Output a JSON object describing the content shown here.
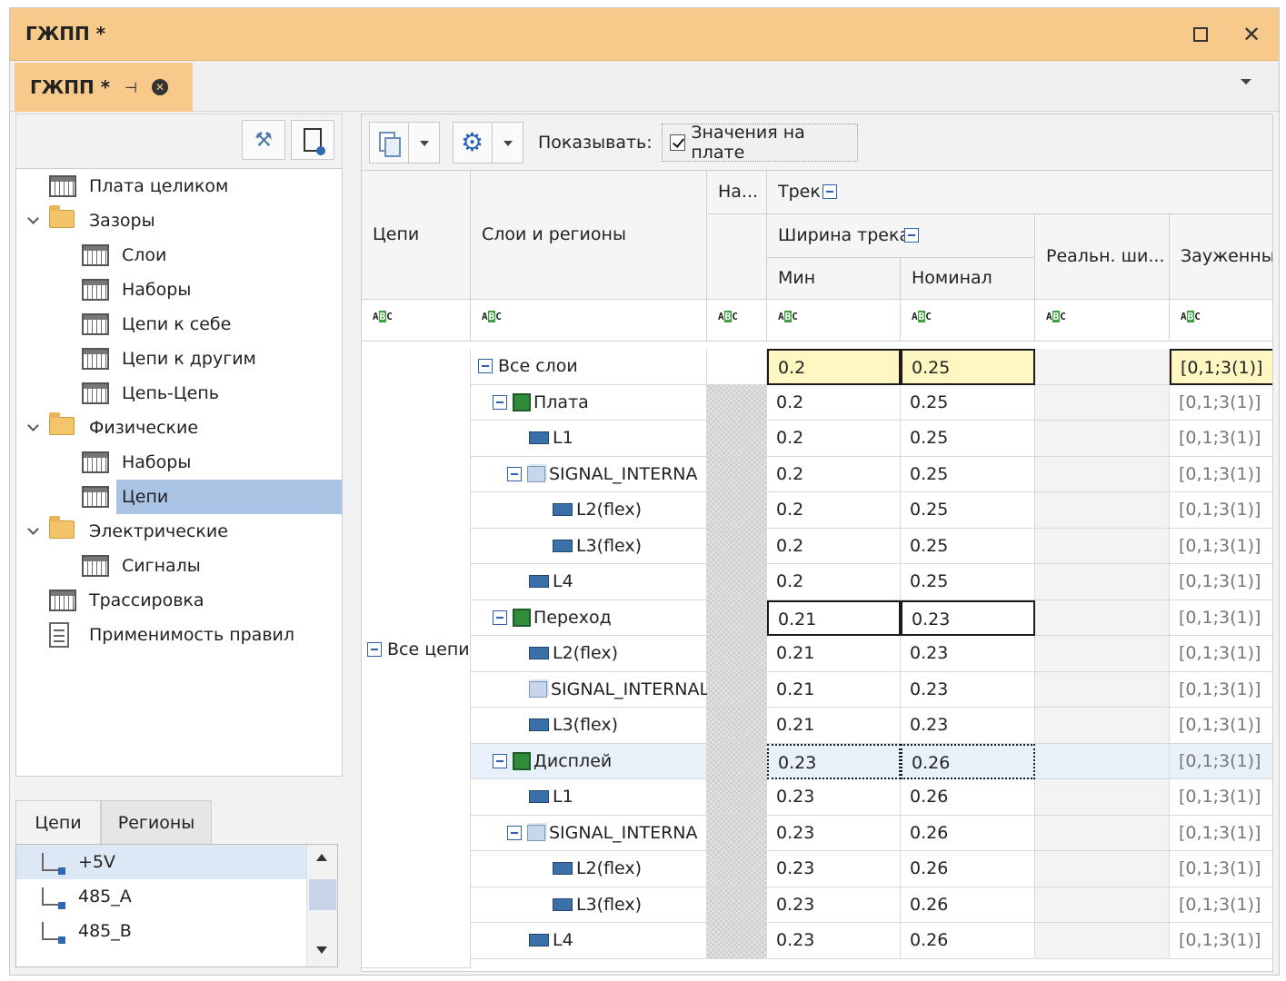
{
  "window": {
    "title": "ГЖПП *"
  },
  "doc_tab": {
    "label": "ГЖПП *"
  },
  "tree": [
    {
      "label": "Плата целиком",
      "icon": "grid-icon",
      "level": 0,
      "expander": false
    },
    {
      "label": "Зазоры",
      "icon": "folder-icon",
      "level": 0,
      "expander": true
    },
    {
      "label": "Слои",
      "icon": "grid-icon",
      "level": 1
    },
    {
      "label": "Наборы",
      "icon": "grid-icon",
      "level": 1
    },
    {
      "label": "Цепи к себе",
      "icon": "grid-icon",
      "level": 1
    },
    {
      "label": "Цепи к другим",
      "icon": "grid-icon",
      "level": 1
    },
    {
      "label": "Цепь-Цепь",
      "icon": "grid-icon",
      "level": 1
    },
    {
      "label": "Физические",
      "icon": "folder-icon",
      "level": 0,
      "expander": true
    },
    {
      "label": "Наборы",
      "icon": "grid-icon",
      "level": 1
    },
    {
      "label": "Цепи",
      "icon": "grid-icon",
      "level": 1,
      "selected": true
    },
    {
      "label": "Электрические",
      "icon": "folder-icon",
      "level": 0,
      "expander": true
    },
    {
      "label": "Сигналы",
      "icon": "grid-icon",
      "level": 1
    },
    {
      "label": "Трассировка",
      "icon": "grid-icon",
      "level": 0
    },
    {
      "label": "Применимость правил",
      "icon": "doc-icon",
      "level": 0
    }
  ],
  "bottom_tabs": [
    "Цепи",
    "Регионы"
  ],
  "nets": [
    "+5V",
    "485_A",
    "485_B"
  ],
  "toolbar": {
    "show_label": "Показывать:",
    "checkbox_label": "Значения на плате"
  },
  "columns": {
    "nets": "Цепи",
    "layers": "Слои и регионы",
    "na": "На...",
    "track": "Трек",
    "width": "Ширина трека",
    "min": "Мин",
    "nominal": "Номинал",
    "real": "Реальн. ши...",
    "neck": "Зауженный"
  },
  "all_nets": "Все цепи",
  "rows": [
    {
      "name": "Все слои",
      "indent": 0,
      "icon": "",
      "expand": true,
      "min": "0.2",
      "nom": "0.25",
      "neck": "[0,1;3(1)]",
      "style": "yellow",
      "hatch": false
    },
    {
      "name": "Плата",
      "indent": 1,
      "icon": "board",
      "expand": true,
      "min": "0.2",
      "nom": "0.25",
      "neck": "[0,1;3(1)]",
      "hatch": true
    },
    {
      "name": "L1",
      "indent": 2,
      "icon": "layer",
      "min": "0.2",
      "nom": "0.25",
      "neck": "[0,1;3(1)]",
      "hatch": true
    },
    {
      "name": "SIGNAL_INTERNA",
      "indent": 2,
      "icon": "set",
      "expand": true,
      "min": "0.2",
      "nom": "0.25",
      "neck": "[0,1;3(1)]",
      "hatch": true
    },
    {
      "name": "L2(flex)",
      "indent": 3,
      "icon": "layer",
      "min": "0.2",
      "nom": "0.25",
      "neck": "[0,1;3(1)]",
      "hatch": true
    },
    {
      "name": "L3(flex)",
      "indent": 3,
      "icon": "layer",
      "min": "0.2",
      "nom": "0.25",
      "neck": "[0,1;3(1)]",
      "hatch": true
    },
    {
      "name": "L4",
      "indent": 2,
      "icon": "layer",
      "min": "0.2",
      "nom": "0.25",
      "neck": "[0,1;3(1)]",
      "hatch": true
    },
    {
      "name": "Переход",
      "indent": 1,
      "icon": "board",
      "expand": true,
      "min": "0.21",
      "nom": "0.23",
      "neck": "[0,1;3(1)]",
      "style": "boxed",
      "hatch": true
    },
    {
      "name": "L2(flex)",
      "indent": 2,
      "icon": "layer",
      "min": "0.21",
      "nom": "0.23",
      "neck": "[0,1;3(1)]",
      "hatch": true
    },
    {
      "name": "SIGNAL_INTERNAL",
      "indent": 2,
      "icon": "set",
      "min": "0.21",
      "nom": "0.23",
      "neck": "[0,1;3(1)]",
      "hatch": true
    },
    {
      "name": "L3(flex)",
      "indent": 2,
      "icon": "layer",
      "min": "0.21",
      "nom": "0.23",
      "neck": "[0,1;3(1)]",
      "hatch": true
    },
    {
      "name": "Дисплей",
      "indent": 1,
      "icon": "board",
      "expand": true,
      "min": "0.23",
      "nom": "0.26",
      "neck": "[0,1;3(1)]",
      "style": "dotted",
      "hatch": true,
      "selected": true
    },
    {
      "name": "L1",
      "indent": 2,
      "icon": "layer",
      "min": "0.23",
      "nom": "0.26",
      "neck": "[0,1;3(1)]",
      "hatch": true
    },
    {
      "name": "SIGNAL_INTERNA",
      "indent": 2,
      "icon": "set",
      "expand": true,
      "min": "0.23",
      "nom": "0.26",
      "neck": "[0,1;3(1)]",
      "hatch": true
    },
    {
      "name": "L2(flex)",
      "indent": 3,
      "icon": "layer",
      "min": "0.23",
      "nom": "0.26",
      "neck": "[0,1;3(1)]",
      "hatch": true
    },
    {
      "name": "L3(flex)",
      "indent": 3,
      "icon": "layer",
      "min": "0.23",
      "nom": "0.26",
      "neck": "[0,1;3(1)]",
      "hatch": true
    },
    {
      "name": "L4",
      "indent": 2,
      "icon": "layer",
      "min": "0.23",
      "nom": "0.26",
      "neck": "[0,1;3(1)]",
      "hatch": true
    }
  ],
  "colors": {
    "accent": "#f7ca8b",
    "selection": "#a9c4e4",
    "highlight": "#fff7c2"
  }
}
